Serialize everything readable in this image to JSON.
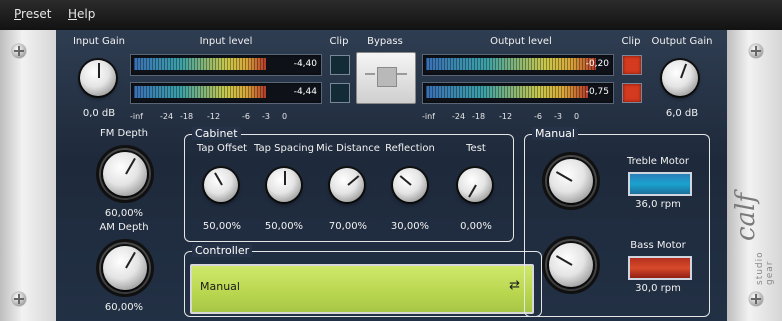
{
  "menu": {
    "preset": "Preset",
    "help": "Help"
  },
  "labels": {
    "input_gain": "Input Gain",
    "input_level": "Input level",
    "clip_in": "Clip",
    "bypass": "Bypass",
    "output_level": "Output level",
    "clip_out": "Clip",
    "output_gain": "Output Gain",
    "fm_depth": "FM Depth",
    "am_depth": "AM Depth",
    "cabinet": "Cabinet",
    "tap_offset": "Tap Offset",
    "tap_spacing": "Tap Spacing",
    "mic_distance": "Mic Distance",
    "reflection": "Reflection",
    "test": "Test",
    "manual": "Manual",
    "treble_motor": "Treble Motor",
    "bass_motor": "Bass Motor",
    "controller": "Controller"
  },
  "values": {
    "input_gain": "0,0 dB",
    "output_gain": "6,0 dB",
    "fm_depth": "60,00%",
    "am_depth": "60,00%",
    "tap_offset": "50,00%",
    "tap_spacing": "50,00%",
    "mic_distance": "70,00%",
    "reflection": "30,00%",
    "test": "0,00%",
    "treble_rpm": "36,0 rpm",
    "bass_rpm": "30,0 rpm"
  },
  "meters": {
    "input_top": "-4,40",
    "input_bottom": "-4,44",
    "output_top": "-0,20",
    "output_bottom": "-0,75"
  },
  "scale": [
    "-inf",
    "-24",
    "-18",
    "-12",
    "-6",
    "-3",
    "0"
  ],
  "controller": {
    "mode": "Manual"
  },
  "brand": {
    "name": "calf",
    "sub": "studio gear"
  },
  "colors": {
    "clip_on": "#d43a1f",
    "treble_motor": "#1aa3d0",
    "bass_motor": "#d84a2a",
    "lcd": "#b9d64f"
  }
}
